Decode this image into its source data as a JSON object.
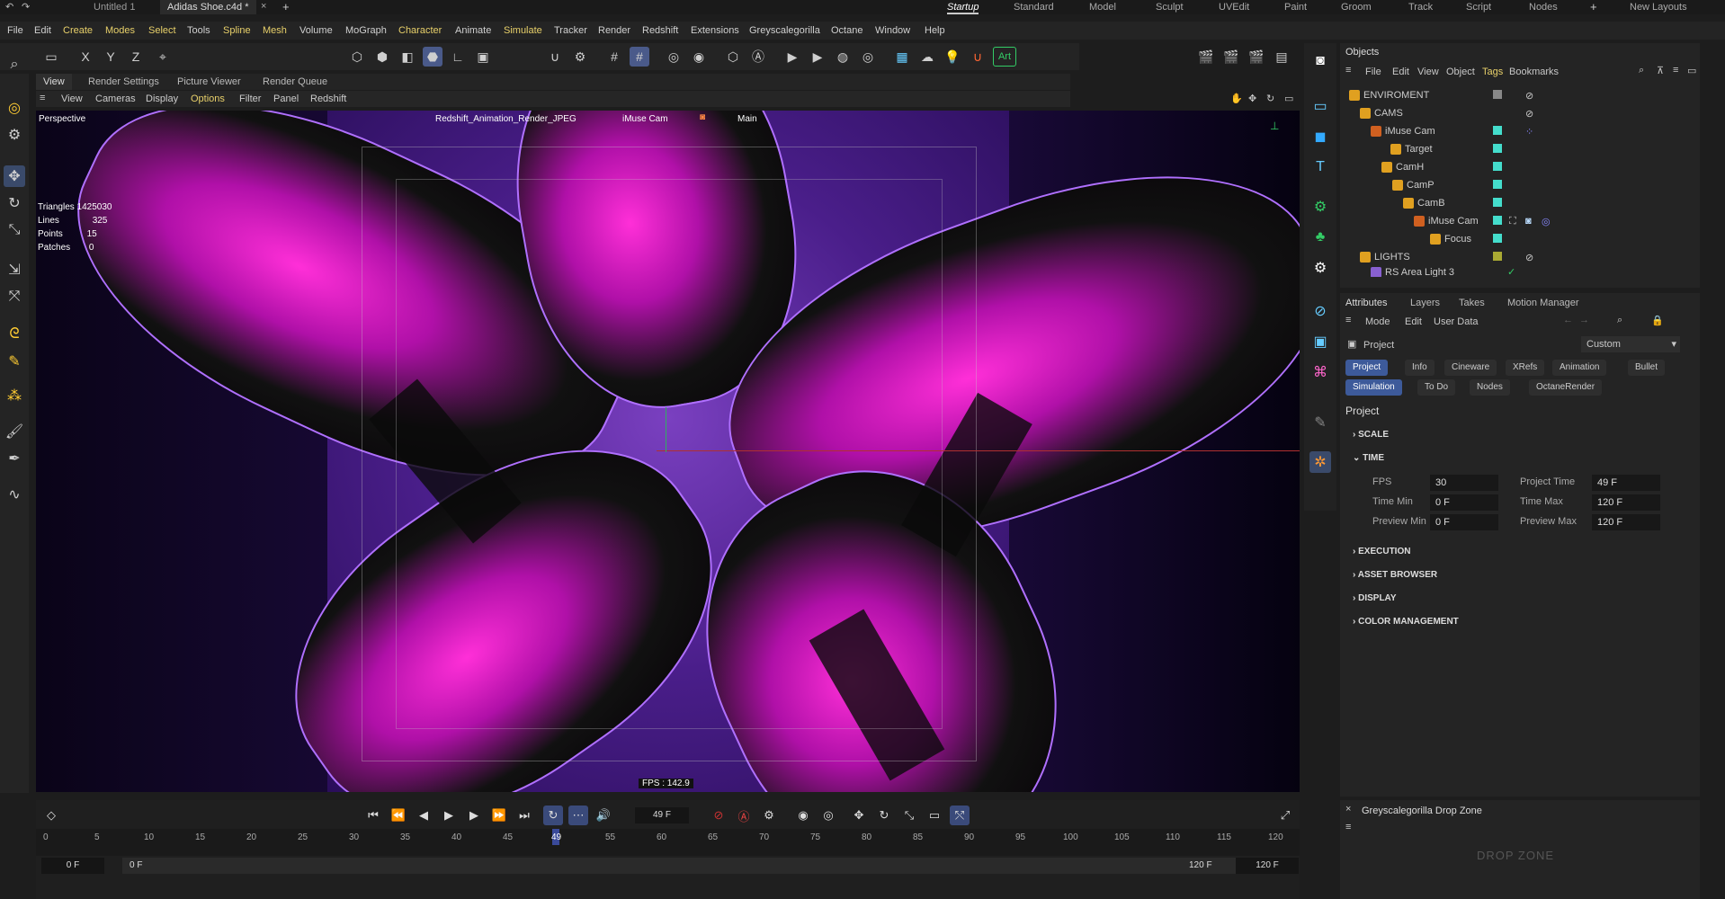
{
  "titlebar": {
    "tabs": [
      {
        "label": "Untitled 1",
        "active": false
      },
      {
        "label": "Adidas Shoe.c4d *",
        "active": true
      }
    ],
    "layouts": [
      "Startup",
      "Standard",
      "Model",
      "Sculpt",
      "UVEdit",
      "Paint",
      "Groom",
      "Track",
      "Script",
      "Nodes"
    ],
    "new_layouts": "New Layouts"
  },
  "menubar": [
    "File",
    "Edit",
    "Create",
    "Modes",
    "Select",
    "Tools",
    "Spline",
    "Mesh",
    "Volume",
    "MoGraph",
    "Character",
    "Animate",
    "Simulate",
    "Tracker",
    "Render",
    "Redshift",
    "Extensions",
    "Greyscalegorilla",
    "Octane",
    "Window",
    "Help"
  ],
  "toolbar": {
    "axis_x": "X",
    "axis_y": "Y",
    "axis_z": "Z",
    "art_label": "Art"
  },
  "viewport_tabs": [
    "View",
    "Render Settings",
    "Picture Viewer",
    "Render Queue"
  ],
  "viewport_menu": [
    "View",
    "Cameras",
    "Display",
    "Options",
    "Filter",
    "Panel",
    "Redshift"
  ],
  "viewport": {
    "name": "Perspective",
    "render_label": "Redshift_Animation_Render_JPEG",
    "camera_label": "iMuse Cam",
    "main_label": "Main",
    "stats": [
      {
        "label": "Triangles",
        "value": "1425030"
      },
      {
        "label": "Lines",
        "value": "325"
      },
      {
        "label": "Points",
        "value": "15"
      },
      {
        "label": "Patches",
        "value": "0"
      }
    ],
    "fps": "FPS : 142.9"
  },
  "timeline": {
    "current_frame": "49 F",
    "ruler": [
      "0",
      "5",
      "10",
      "15",
      "20",
      "25",
      "30",
      "35",
      "40",
      "45",
      "49",
      "55",
      "60",
      "65",
      "70",
      "75",
      "80",
      "85",
      "90",
      "95",
      "100",
      "105",
      "110",
      "115",
      "120"
    ],
    "start_a": "0 F",
    "start_b": "0 F",
    "end_a": "120 F",
    "end_b": "120 F"
  },
  "objects_panel": {
    "title": "Objects",
    "menu": [
      "File",
      "Edit",
      "View",
      "Object",
      "Tags",
      "Bookmarks"
    ],
    "rows": [
      {
        "name": "ENVIROMENT",
        "indent": 0,
        "type": "folder"
      },
      {
        "name": "CAMS",
        "indent": 1,
        "type": "folder"
      },
      {
        "name": "iMuse Cam",
        "indent": 2,
        "type": "cam"
      },
      {
        "name": "Target",
        "indent": 3,
        "type": "null"
      },
      {
        "name": "CamH",
        "indent": 3,
        "type": "null"
      },
      {
        "name": "CamP",
        "indent": 4,
        "type": "null"
      },
      {
        "name": "CamB",
        "indent": 5,
        "type": "null"
      },
      {
        "name": "iMuse Cam",
        "indent": 6,
        "type": "cam"
      },
      {
        "name": "Focus",
        "indent": 7,
        "type": "null"
      },
      {
        "name": "LIGHTS",
        "indent": 1,
        "type": "folder"
      },
      {
        "name": "RS Area Light 3",
        "indent": 2,
        "type": "light"
      }
    ]
  },
  "attributes_panel": {
    "tabs": [
      "Attributes",
      "Layers",
      "Takes",
      "Motion Manager"
    ],
    "menu": [
      "Mode",
      "Edit",
      "User Data"
    ],
    "object": "Project",
    "preset": "Custom",
    "buttons_row1": [
      "Project",
      "Info",
      "Cineware",
      "XRefs",
      "Animation",
      "Bullet"
    ],
    "buttons_row2": [
      "Simulation",
      "To Do",
      "Nodes",
      "OctaneRender"
    ],
    "heading": "Project",
    "sections": [
      "SCALE",
      "TIME",
      "EXECUTION",
      "ASSET BROWSER",
      "DISPLAY",
      "COLOR MANAGEMENT"
    ],
    "fields": {
      "fps_label": "FPS",
      "fps": "30",
      "project_time_label": "Project Time",
      "project_time": "49 F",
      "time_min_label": "Time Min",
      "time_min": "0 F",
      "time_max_label": "Time Max",
      "time_max": "120 F",
      "preview_min_label": "Preview Min",
      "preview_min": "0 F",
      "preview_max_label": "Preview Max",
      "preview_max": "120 F"
    }
  },
  "dropzone": {
    "title": "Greyscalegorilla Drop Zone",
    "logo": "DROP ZONE"
  }
}
